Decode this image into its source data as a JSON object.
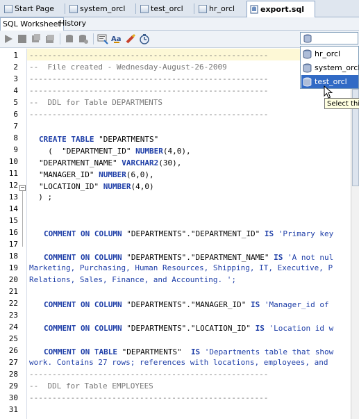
{
  "tabs": [
    {
      "label": "Start Page",
      "icon": "start-page-icon"
    },
    {
      "label": "system_orcl",
      "icon": "sql-worksheet-icon"
    },
    {
      "label": "test_orcl",
      "icon": "sql-worksheet-icon"
    },
    {
      "label": "hr_orcl",
      "icon": "sql-worksheet-icon"
    },
    {
      "label": "export.sql",
      "icon": "sql-file-icon",
      "active": true
    }
  ],
  "subtabs": [
    "SQL Worksheet",
    "History"
  ],
  "toolbar_icons": [
    "run-statement-icon",
    "run-script-icon",
    "commit-icon",
    "rollback-icon",
    "cancel-icon",
    "sql-tuning-icon",
    "format-icon",
    "clear-icon",
    "history-icon"
  ],
  "connection": {
    "options": [
      "hr_orcl",
      "system_orcl",
      "test_orcl"
    ],
    "highlighted": "test_orcl",
    "tooltip": "Select this"
  },
  "colors": {
    "keyword": "#1f3fa8",
    "comment": "#777777",
    "selection": "#316ac5",
    "current_line": "#fdf8d6"
  },
  "editor": {
    "lines": [
      {
        "n": "1",
        "text": "----------------------------------------------------",
        "cls": "cmt"
      },
      {
        "n": "2",
        "text": "--  File created - Wednesday-August-26-2009",
        "cls": "cmt"
      },
      {
        "n": "3",
        "text": "----------------------------------------------------",
        "cls": "cmt"
      },
      {
        "n": "4",
        "text": "----------------------------------------------------",
        "cls": "cmt"
      },
      {
        "n": "5",
        "text": "--  DDL for Table DEPARTMENTS",
        "cls": "cmt"
      },
      {
        "n": "6",
        "text": "----------------------------------------------------",
        "cls": "cmt"
      },
      {
        "n": "7",
        "text": "",
        "cls": ""
      },
      {
        "n": "8",
        "text": "",
        "cls": ""
      },
      {
        "n": "9",
        "text": "",
        "cls": ""
      },
      {
        "n": "10",
        "text": "",
        "cls": ""
      },
      {
        "n": "11",
        "text": "",
        "cls": ""
      },
      {
        "n": "12",
        "text": "",
        "cls": ""
      },
      {
        "n": "13",
        "text": "  ) ;",
        "cls": ""
      },
      {
        "n": "14",
        "text": "",
        "cls": ""
      },
      {
        "n": "15",
        "text": "",
        "cls": ""
      },
      {
        "n": "16",
        "text": "",
        "cls": ""
      },
      {
        "n": "17",
        "text": "",
        "cls": ""
      },
      {
        "n": "18",
        "text": "",
        "cls": ""
      },
      {
        "n": "19",
        "text": "Marketing, Purchasing, Human Resources, Shipping, IT, Executive, P",
        "cls": "str"
      },
      {
        "n": "20",
        "text": "Relations, Sales, Finance, and Accounting. ';",
        "cls": "str"
      },
      {
        "n": "21",
        "text": "",
        "cls": ""
      },
      {
        "n": "22",
        "text": "",
        "cls": ""
      },
      {
        "n": "23",
        "text": "",
        "cls": ""
      },
      {
        "n": "24",
        "text": "",
        "cls": ""
      },
      {
        "n": "25",
        "text": "",
        "cls": ""
      },
      {
        "n": "26",
        "text": "",
        "cls": ""
      },
      {
        "n": "27",
        "text": "work. Contains 27 rows; references with locations, employees, and",
        "cls": "str"
      },
      {
        "n": "28",
        "text": "----------------------------------------------------",
        "cls": "cmt"
      },
      {
        "n": "29",
        "text": "--  DDL for Table EMPLOYEES",
        "cls": "cmt"
      },
      {
        "n": "30",
        "text": "----------------------------------------------------",
        "cls": "cmt"
      },
      {
        "n": "31",
        "text": "",
        "cls": ""
      }
    ],
    "rich": {
      "l8a": "CREATE TABLE",
      "l8b": " \"DEPARTMENTS\"",
      "l9a": "  (  \"DEPARTMENT_ID\" ",
      "l9b": "NUMBER",
      "l9c": "(4,0),",
      "l10a": "\"DEPARTMENT_NAME\" ",
      "l10b": "VARCHAR2",
      "l10c": "(30),",
      "l11a": "\"MANAGER_ID\" ",
      "l11b": "NUMBER",
      "l11c": "(6,0),",
      "l12a": "\"LOCATION_ID\" ",
      "l12b": "NUMBER",
      "l12c": "(4,0)",
      "l16a": "COMMENT ON COLUMN",
      "l16b": " \"DEPARTMENTS\".\"DEPARTMENT_ID\" ",
      "l16c": "IS",
      "l16d": " 'Primary key",
      "l18a": "COMMENT ON COLUMN",
      "l18b": " \"DEPARTMENTS\".\"DEPARTMENT_NAME\" ",
      "l18c": "IS",
      "l18d": " 'A not nul",
      "l22a": "COMMENT ON COLUMN",
      "l22b": " \"DEPARTMENTS\".\"MANAGER_ID\" ",
      "l22c": "IS",
      "l22d": " 'Manager_id of",
      "l24a": "COMMENT ON COLUMN",
      "l24b": " \"DEPARTMENTS\".\"LOCATION_ID\" ",
      "l24c": "IS",
      "l24d": " 'Location id w",
      "l26a": "COMMENT ON TABLE",
      "l26b": " \"DEPARTMENTS\"  ",
      "l26c": "IS",
      "l26d": " 'Departments table that show"
    }
  }
}
